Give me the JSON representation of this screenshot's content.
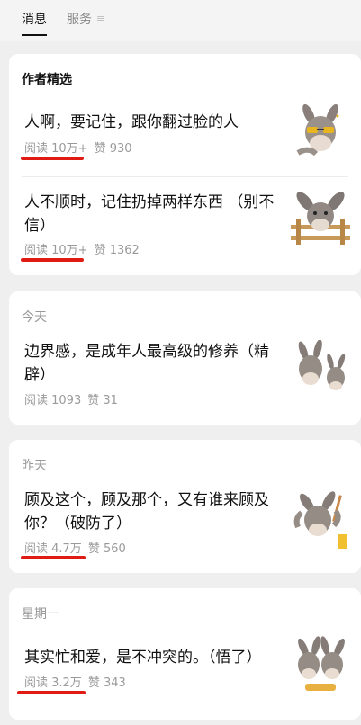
{
  "tabs": {
    "messages": "消息",
    "services": "服务",
    "services_menu_icon": "≡"
  },
  "featured": {
    "heading": "作者精选",
    "articles": [
      {
        "title": "人啊，要记住，跟你翻过脸的人",
        "reads": "阅读 10万+",
        "likes": "赞 930",
        "thumb": "donkey-sunglasses"
      },
      {
        "title": "人不顺时，记住扔掉两样东西 （别不信）",
        "reads": "阅读 10万+",
        "likes": "赞 1362",
        "thumb": "donkey-fence"
      }
    ]
  },
  "groups": [
    {
      "date": "今天",
      "title": "边界感，是成年人最高级的修养（精辟）",
      "reads": "阅读 1093",
      "likes": "赞 31",
      "thumb": "donkey-pair"
    },
    {
      "date": "昨天",
      "title": "顾及这个，顾及那个，又有谁来顾及你？（破防了）",
      "reads": "阅读 4.7万",
      "likes": "赞 560",
      "thumb": "donkey-stressed"
    },
    {
      "date": "星期一",
      "title": "其实忙和爱，是不冲突的。（悟了）",
      "reads": "阅读 3.2万",
      "likes": "赞 343",
      "thumb": "donkey-eating"
    }
  ],
  "colors": {
    "underline": "#e01b14",
    "meta": "#9a9a9a",
    "background": "#efefef"
  }
}
